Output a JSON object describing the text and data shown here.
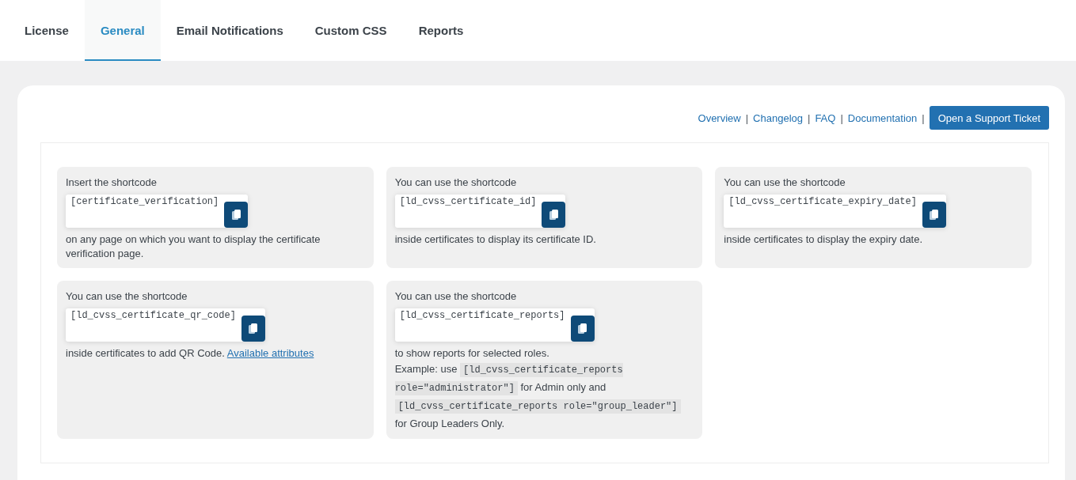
{
  "tabs": [
    {
      "label": "License",
      "selected": false
    },
    {
      "label": "General",
      "selected": true
    },
    {
      "label": "Email Notifications",
      "selected": false
    },
    {
      "label": "Custom CSS",
      "selected": false
    },
    {
      "label": "Reports",
      "selected": false
    }
  ],
  "support_links": [
    {
      "kind": "link",
      "text": "Overview"
    },
    {
      "kind": "separator",
      "text": "|"
    },
    {
      "kind": "link",
      "text": "Changelog"
    },
    {
      "kind": "separator",
      "text": "|"
    },
    {
      "kind": "link",
      "text": "FAQ"
    },
    {
      "kind": "separator",
      "text": "|"
    },
    {
      "kind": "link",
      "text": "Documentation"
    },
    {
      "kind": "separator",
      "text": "|"
    }
  ],
  "support_button": "Open a Support Ticket",
  "cards": [
    {
      "intro": "Insert the shortcode",
      "shortcode": "[certificate_verification]",
      "paragraphs": [
        [
          {
            "kind": "text",
            "text": "on any page on which you want to display the certificate verification page."
          }
        ]
      ]
    },
    {
      "intro": "You can use the shortcode",
      "shortcode": "[ld_cvss_certificate_id]",
      "paragraphs": [
        [
          {
            "kind": "text",
            "text": "inside certificates to display its certificate ID."
          }
        ]
      ]
    },
    {
      "intro": "You can use the shortcode",
      "shortcode": "[ld_cvss_certificate_expiry_date]",
      "paragraphs": [
        [
          {
            "kind": "text",
            "text": "inside certificates to display the expiry date."
          }
        ]
      ]
    },
    {
      "intro": "You can use the shortcode",
      "shortcode": "[ld_cvss_certificate_qr_code]",
      "paragraphs": [
        [
          {
            "kind": "text",
            "text": "inside certificates to add QR Code. "
          },
          {
            "kind": "link",
            "text": "Available attributes"
          }
        ]
      ]
    },
    {
      "intro": "You can use the shortcode",
      "shortcode": "[ld_cvss_certificate_reports]",
      "paragraphs": [
        [
          {
            "kind": "text",
            "text": "to show reports for selected roles."
          }
        ],
        [
          {
            "kind": "text",
            "text": "Example: use "
          },
          {
            "kind": "code",
            "text": "[ld_cvss_certificate_reports role=\"administrator\"]"
          },
          {
            "kind": "text",
            "text": " for Admin only and "
          },
          {
            "kind": "code",
            "text": "[ld_cvss_certificate_reports role=\"group_leader\"]"
          },
          {
            "kind": "text",
            "text": " for Group Leaders Only."
          }
        ]
      ]
    }
  ]
}
